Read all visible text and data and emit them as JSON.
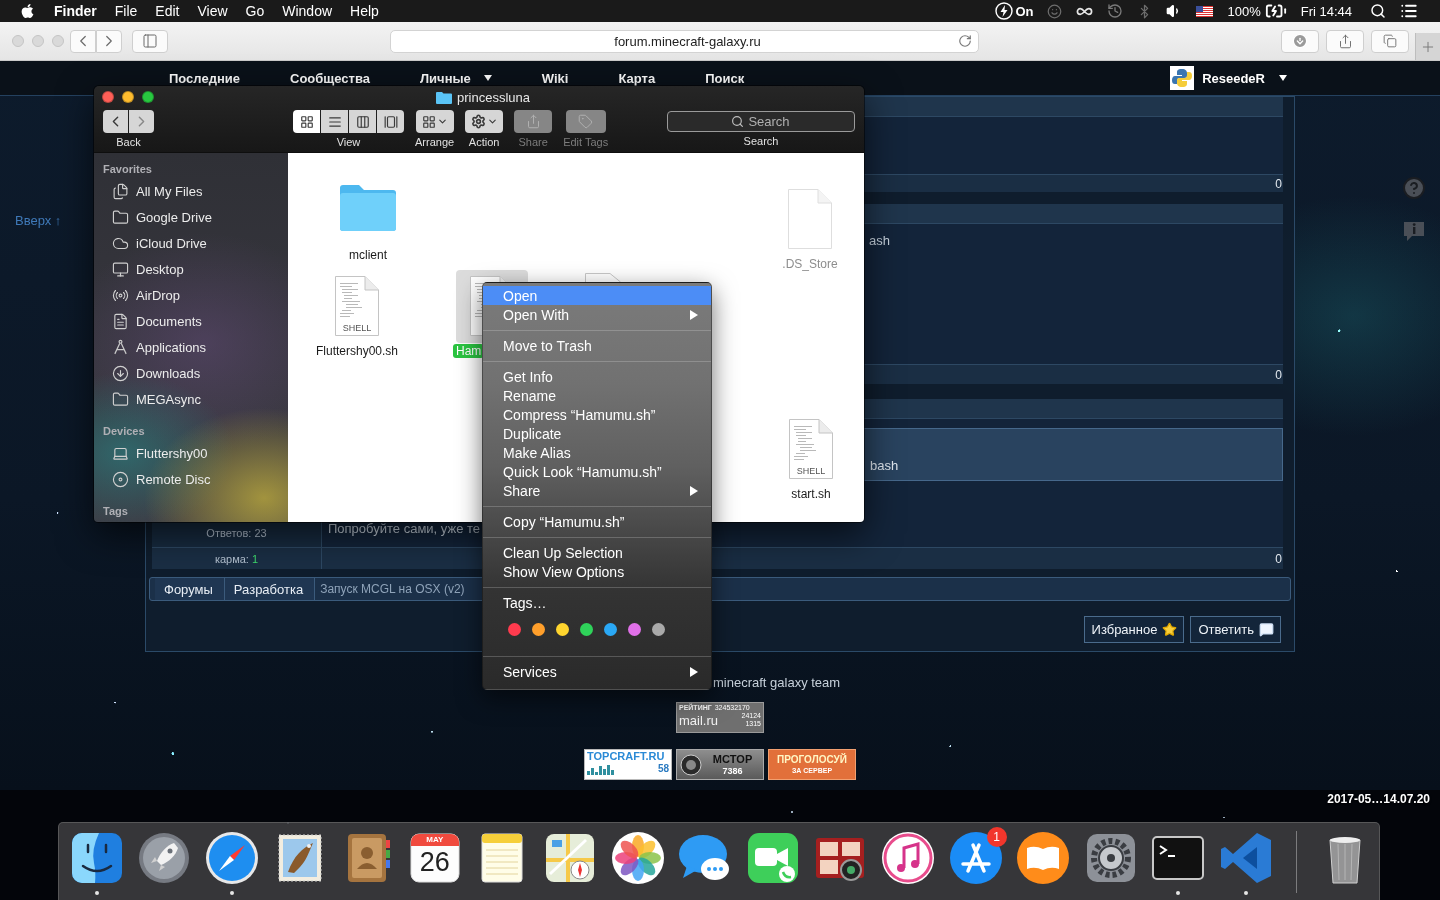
{
  "menubar": {
    "app": "Finder",
    "menus": [
      "File",
      "Edit",
      "View",
      "Go",
      "Window",
      "Help"
    ],
    "power_label": "On",
    "battery": "100%",
    "clock": "Fri 14:44"
  },
  "browser": {
    "url": "forum.minecraft-galaxy.ru"
  },
  "forum": {
    "nav": [
      {
        "label": "Последние",
        "dropdown": false
      },
      {
        "label": "Сообщества",
        "dropdown": false
      },
      {
        "label": "Личные",
        "dropdown": true
      },
      {
        "label": "Wiki",
        "dropdown": false
      },
      {
        "label": "Карта",
        "dropdown": false
      },
      {
        "label": "Поиск",
        "dropdown": false
      }
    ],
    "user": {
      "name": "ReseedeR",
      "dropdown": true
    },
    "back_to_top": "Вверх ↑",
    "posts": [
      {
        "score": "0"
      },
      {
        "text": "ash",
        "score": "0"
      },
      {
        "code": "bash",
        "text": "Попробуйте сами, уже те",
        "replies": "Ответов: 23",
        "karma_label": "карма:",
        "karma_value": "1",
        "score": "0"
      }
    ],
    "breadcrumbs": [
      {
        "label": "Форумы",
        "current": false
      },
      {
        "label": "Разработка",
        "current": false
      },
      {
        "label": "Запуск MCGL на OSX (v2)",
        "current": true
      }
    ],
    "actions": [
      {
        "label": "Избранное"
      },
      {
        "label": "Ответить"
      }
    ],
    "footer": {
      "credit": "minecraft galaxy team",
      "rating": {
        "title": "РЕЙТИНГ",
        "count": "324532170",
        "logo": "mail.ru",
        "stats": [
          "24124",
          "1315"
        ]
      },
      "counters": [
        {
          "kind": "topcraft",
          "title": "TOPCRAFT.RU",
          "value": "58"
        },
        {
          "kind": "mctop",
          "title": "MCTOP",
          "value": "7386"
        },
        {
          "kind": "vote",
          "title": "ПРОГОЛОСУЙ",
          "value": "ЗА СЕРВЕР"
        }
      ]
    }
  },
  "desktop": {
    "file_label": "2017-05…14.07.20"
  },
  "dock": {
    "apps": [
      {
        "running": true
      },
      {
        "running": false
      },
      {
        "running": true
      },
      {
        "running": false
      },
      {
        "running": false
      },
      {
        "running": false,
        "month": "MAY",
        "day": "26"
      },
      {
        "running": false
      },
      {
        "running": false
      },
      {
        "running": false
      },
      {
        "running": false
      },
      {
        "running": false
      },
      {
        "running": false
      },
      {
        "running": false
      },
      {
        "running": false,
        "badge": "1"
      },
      {
        "running": false
      },
      {
        "running": false
      },
      {
        "running": true
      },
      {
        "running": true
      }
    ]
  },
  "finder": {
    "title": "princessluna",
    "back_label": "Back",
    "view_label": "View",
    "views": [
      {
        "selected": true
      },
      {
        "selected": false
      },
      {
        "selected": false
      },
      {
        "selected": false
      }
    ],
    "tools": [
      {
        "label": "Arrange",
        "disabled": false
      },
      {
        "label": "Action",
        "disabled": false
      },
      {
        "label": "Share",
        "disabled": true
      },
      {
        "label": "Edit Tags",
        "disabled": true
      }
    ],
    "search": {
      "placeholder": "Search",
      "label": "Search"
    },
    "sidebar": [
      {
        "heading": "Favorites",
        "items": [
          {
            "label": "All My Files",
            "selected": false
          },
          {
            "label": "Google Drive",
            "selected": false
          },
          {
            "label": "iCloud Drive",
            "selected": false
          },
          {
            "label": "Desktop",
            "selected": false
          },
          {
            "label": "AirDrop",
            "selected": false
          },
          {
            "label": "Documents",
            "selected": false
          },
          {
            "label": "Applications",
            "selected": false
          },
          {
            "label": "Downloads",
            "selected": false
          },
          {
            "label": "MEGAsync",
            "selected": false
          }
        ]
      },
      {
        "heading": "Devices",
        "items": [
          {
            "label": "Fluttershy00",
            "selected": false
          },
          {
            "label": "Remote Disc",
            "selected": false
          }
        ]
      },
      {
        "heading": "Tags"
      }
    ],
    "files": [
      {
        "name": "mclient",
        "kind": "folder",
        "selected": false,
        "dimmed": false
      },
      {
        "name": ".DS_Store",
        "kind": "document",
        "selected": false,
        "dimmed": true
      },
      {
        "name": "Fluttershy00.sh",
        "kind": "shell",
        "type_label": "SHELL",
        "selected": false,
        "dimmed": false
      },
      {
        "name": "Ham",
        "kind": "shell",
        "selected": true,
        "dimmed": false
      },
      {
        "kind": "document",
        "selected": false,
        "dimmed": false
      },
      {
        "name": "start.sh",
        "kind": "shell",
        "type_label": "SHELL",
        "selected": false,
        "dimmed": false
      }
    ]
  },
  "context_menu": {
    "groups": [
      {
        "items": [
          {
            "label": "Open",
            "selected": true,
            "submenu": false
          },
          {
            "label": "Open With",
            "selected": false,
            "submenu": true
          }
        ]
      },
      {
        "items": [
          {
            "label": "Move to Trash",
            "selected": false,
            "submenu": false
          }
        ]
      },
      {
        "items": [
          {
            "label": "Get Info",
            "selected": false,
            "submenu": false
          },
          {
            "label": "Rename",
            "selected": false,
            "submenu": false
          },
          {
            "label": "Compress “Hamumu.sh”",
            "selected": false,
            "submenu": false
          },
          {
            "label": "Duplicate",
            "selected": false,
            "submenu": false
          },
          {
            "label": "Make Alias",
            "selected": false,
            "submenu": false
          },
          {
            "label": "Quick Look “Hamumu.sh”",
            "selected": false,
            "submenu": false
          },
          {
            "label": "Share",
            "selected": false,
            "submenu": true
          }
        ]
      },
      {
        "items": [
          {
            "label": "Copy “Hamumu.sh”",
            "selected": false,
            "submenu": false
          }
        ]
      },
      {
        "items": [
          {
            "label": "Clean Up Selection",
            "selected": false,
            "submenu": false
          },
          {
            "label": "Show View Options",
            "selected": false,
            "submenu": false
          }
        ]
      },
      {
        "items": [
          {
            "label": "Tags…",
            "selected": false,
            "submenu": false
          }
        ],
        "tag_colors": [
          {
            "color": "#ff3b4e"
          },
          {
            "color": "#ff9f2b"
          },
          {
            "color": "#ffd52e"
          },
          {
            "color": "#2fd35a"
          },
          {
            "color": "#2aa8f5"
          },
          {
            "color": "#e070e8"
          },
          {
            "color": "#a9a9a9"
          }
        ]
      },
      {
        "items": [
          {
            "label": "Services",
            "selected": false,
            "submenu": true
          }
        ]
      }
    ]
  }
}
